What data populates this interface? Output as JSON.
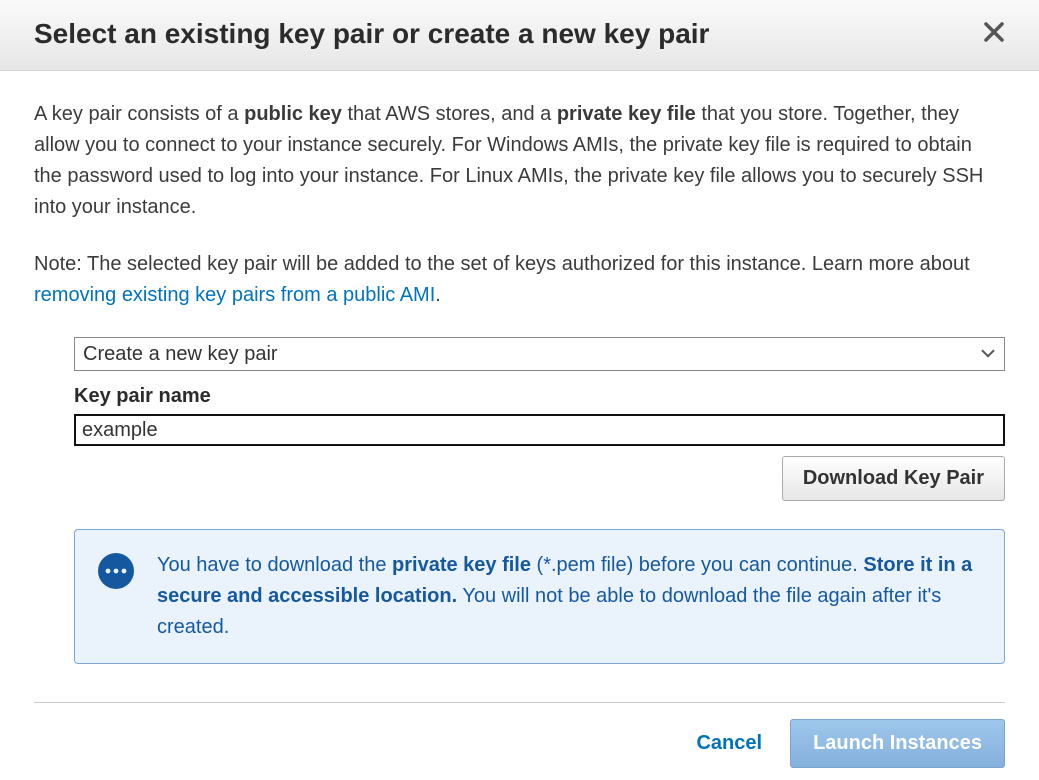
{
  "header": {
    "title": "Select an existing key pair or create a new key pair"
  },
  "description": {
    "p1_a": "A key pair consists of a ",
    "p1_b1": "public key",
    "p1_c": " that AWS stores, and a ",
    "p1_b2": "private key file",
    "p1_d": " that you store. Together, they allow you to connect to your instance securely. For Windows AMIs, the private key file is required to obtain the password used to log into your instance. For Linux AMIs, the private key file allows you to securely SSH into your instance.",
    "p2_a": "Note: The selected key pair will be added to the set of keys authorized for this instance. Learn more about ",
    "p2_link": "removing existing key pairs from a public AMI",
    "p2_b": "."
  },
  "form": {
    "select_value": "Create a new key pair",
    "label": "Key pair name",
    "input_value": "example",
    "download_label": "Download Key Pair"
  },
  "info": {
    "t1": "You have to download the ",
    "b1": "private key file",
    "t2": " (*.pem file) before you can continue. ",
    "b2": "Store it in a secure and accessible location.",
    "t3": " You will not be able to download the file again after it's created."
  },
  "footer": {
    "cancel": "Cancel",
    "launch": "Launch Instances"
  }
}
